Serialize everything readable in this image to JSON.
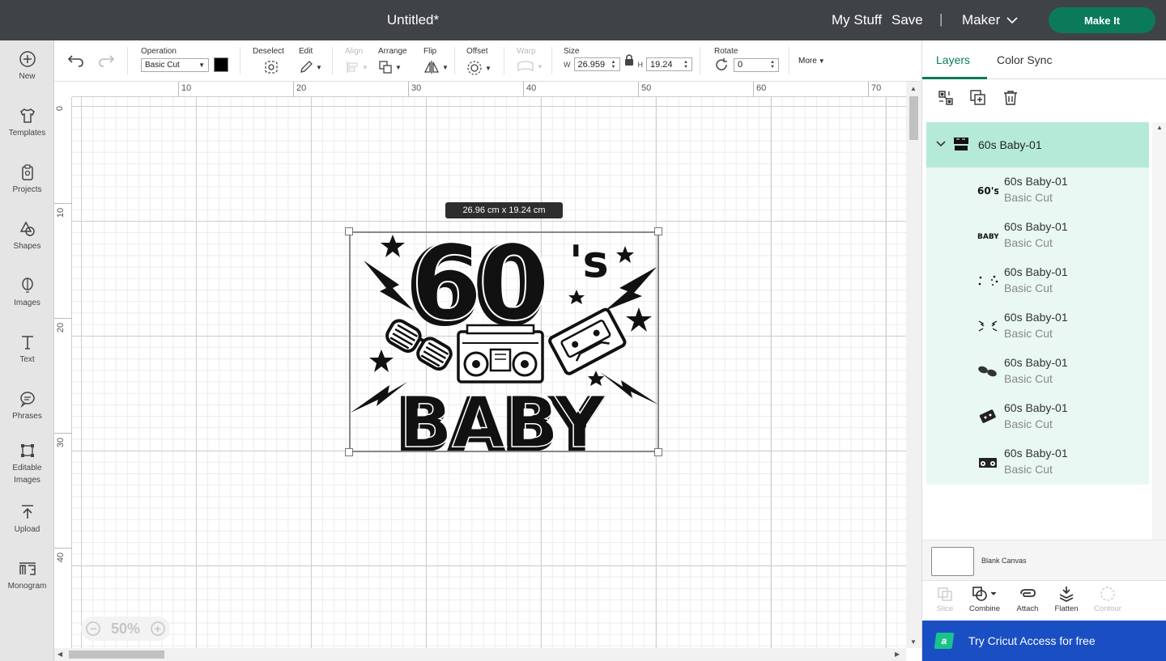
{
  "header": {
    "title": "Untitled*",
    "my_stuff": "My Stuff",
    "save": "Save",
    "machine": "Maker",
    "make_it": "Make It",
    "colors": {
      "bar": "#3f4348",
      "accent": "#0b7a5a"
    }
  },
  "sidebar": {
    "items": [
      {
        "label": "New",
        "icon": "plus-circle-icon"
      },
      {
        "label": "Templates",
        "icon": "shirt-icon"
      },
      {
        "label": "Projects",
        "icon": "clipboard-icon"
      },
      {
        "label": "Shapes",
        "icon": "shapes-icon"
      },
      {
        "label": "Images",
        "icon": "balloon-icon"
      },
      {
        "label": "Text",
        "icon": "text-icon"
      },
      {
        "label": "Phrases",
        "icon": "speech-bubble-icon"
      },
      {
        "label": "Editable Images",
        "icon": "editable-image-icon"
      },
      {
        "label": "Upload",
        "icon": "upload-icon"
      },
      {
        "label": "Monogram",
        "icon": "monogram-icon"
      }
    ]
  },
  "toolbar": {
    "operation_label": "Operation",
    "operation_value": "Basic Cut",
    "operation_color": "#000000",
    "deselect": "Deselect",
    "edit": "Edit",
    "align": "Align",
    "arrange": "Arrange",
    "flip": "Flip",
    "offset": "Offset",
    "warp": "Warp",
    "size_label": "Size",
    "w_label": "W",
    "w_value": "26.959",
    "h_label": "H",
    "h_value": "19.24",
    "rotate_label": "Rotate",
    "rotate_value": "0",
    "more": "More"
  },
  "canvas": {
    "ruler_top": [
      "10",
      "20",
      "30",
      "40",
      "50",
      "60",
      "70"
    ],
    "ruler_left": [
      "0",
      "10",
      "20",
      "30",
      "40"
    ],
    "size_tooltip": "26.96  cm x 19.24  cm",
    "zoom": "50%",
    "artwork": {
      "line1": "60",
      "line1_suffix": "'s",
      "line2": "BABY"
    }
  },
  "panel": {
    "tabs": [
      "Layers",
      "Color Sync"
    ],
    "group_name": "60s Baby-01",
    "layers": [
      {
        "name": "60s Baby-01",
        "operation": "Basic Cut",
        "thumb": "60s-text-thumb"
      },
      {
        "name": "60s Baby-01",
        "operation": "Basic Cut",
        "thumb": "baby-text-thumb"
      },
      {
        "name": "60s Baby-01",
        "operation": "Basic Cut",
        "thumb": "stars-thumb"
      },
      {
        "name": "60s Baby-01",
        "operation": "Basic Cut",
        "thumb": "lightning-thumb"
      },
      {
        "name": "60s Baby-01",
        "operation": "Basic Cut",
        "thumb": "sunglasses-thumb"
      },
      {
        "name": "60s Baby-01",
        "operation": "Basic Cut",
        "thumb": "cassette-thumb"
      },
      {
        "name": "60s Baby-01",
        "operation": "Basic Cut",
        "thumb": "boombox-thumb"
      }
    ],
    "blank_canvas": "Blank Canvas",
    "actions": [
      {
        "label": "Slice",
        "enabled": false
      },
      {
        "label": "Combine",
        "enabled": true
      },
      {
        "label": "Attach",
        "enabled": true
      },
      {
        "label": "Flatten",
        "enabled": true
      },
      {
        "label": "Contour",
        "enabled": false
      }
    ],
    "cta": "Try Cricut Access for free",
    "cta_logo": "a"
  }
}
